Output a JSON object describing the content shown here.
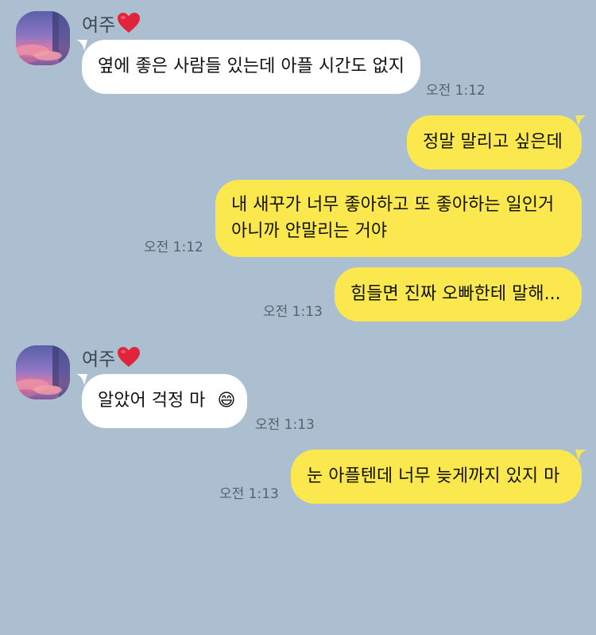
{
  "messages": [
    {
      "sender": "여주",
      "text": "옆에 좋은 사람들 있는데 아플 시간도 없지",
      "time": "오전 1:12"
    },
    {
      "text": "정말 말리고 싶은데"
    },
    {
      "line1": "내 새꾸가 너무 좋아하고 또 좋아하는 일인거",
      "line2": "아니까 안말리는 거야",
      "time": "오전 1:12"
    },
    {
      "text": "힘들면 진짜 오빠한테 말해...",
      "time": "오전 1:13"
    },
    {
      "sender": "여주",
      "text": "알았어 걱정 마",
      "emoji": "😄",
      "time": "오전 1:13"
    },
    {
      "text": "눈 아플텐데 너무 늦게까지 있지 마",
      "time": "오전 1:13"
    }
  ],
  "colors": {
    "background": "#abbfd0",
    "incoming_bubble": "#ffffff",
    "outgoing_bubble": "#fbe84e",
    "heart": "#e0243b"
  },
  "icons": {
    "avatar": "profile-photo-sunset",
    "heart": "red-heart-emoji"
  }
}
